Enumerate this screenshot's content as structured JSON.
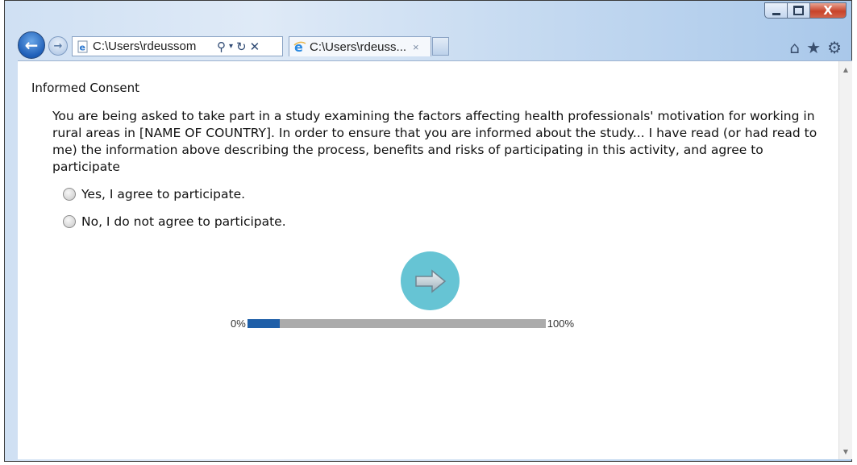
{
  "browser": {
    "address_text": "C:\\Users\\rdeussom",
    "tab_title": "C:\\Users\\rdeuss...",
    "tab_close": "×",
    "window_controls": {
      "close_label": "X"
    },
    "icons": [
      "back-arrow-icon",
      "forward-arrow-icon",
      "ie-logo-icon",
      "search-icon",
      "refresh-icon",
      "stop-icon",
      "home-icon",
      "favorites-star-icon",
      "gear-icon"
    ]
  },
  "page": {
    "title": "Informed Consent",
    "consent_text": "You are being asked to take part in a study examining the factors affecting health professionals' motivation for working in rural areas in [NAME OF COUNTRY]. In order to ensure that you are informed about the study... I have read (or had read to me) the information above describing the process, benefits and risks of participating in this activity, and agree to participate",
    "options": [
      {
        "label": "Yes, I agree to participate.",
        "selected": false
      },
      {
        "label": "No, I do not agree to participate.",
        "selected": false
      }
    ],
    "next_button_icon": "right-arrow-icon",
    "progress": {
      "min_label": "0%",
      "max_label": "100%",
      "value_percent": 11
    }
  },
  "colors": {
    "next_button": "#66c4d4",
    "progress_fill": "#1f5fa8",
    "progress_track": "#ababab",
    "close_button": "#c8432a"
  }
}
